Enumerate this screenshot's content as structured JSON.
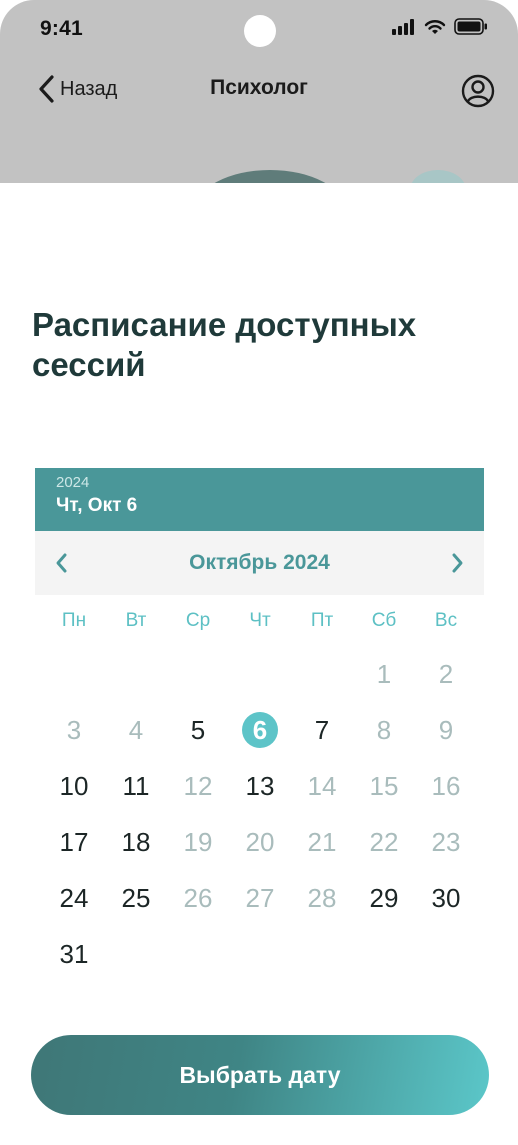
{
  "status_bar": {
    "time": "9:41",
    "icons": [
      "signal-icon",
      "wifi-icon",
      "battery-icon"
    ]
  },
  "nav": {
    "back_label": "Назад",
    "title": "Психолог",
    "profile_icon": "user-circle-icon"
  },
  "heading": "Расписание доступных сессий",
  "calendar": {
    "year": "2024",
    "selected_label": "Чт, Окт 6",
    "month_label": "Октябрь 2024",
    "weekdays": [
      "Пн",
      "Вт",
      "Ср",
      "Чт",
      "Пт",
      "Сб",
      "Вс"
    ],
    "leading_blanks": 5,
    "days": [
      {
        "n": "1",
        "state": "disabled"
      },
      {
        "n": "2",
        "state": "disabled"
      },
      {
        "n": "3",
        "state": "disabled"
      },
      {
        "n": "4",
        "state": "disabled"
      },
      {
        "n": "5",
        "state": "available"
      },
      {
        "n": "6",
        "state": "selected"
      },
      {
        "n": "7",
        "state": "available"
      },
      {
        "n": "8",
        "state": "disabled"
      },
      {
        "n": "9",
        "state": "disabled"
      },
      {
        "n": "10",
        "state": "available"
      },
      {
        "n": "11",
        "state": "available"
      },
      {
        "n": "12",
        "state": "disabled"
      },
      {
        "n": "13",
        "state": "available"
      },
      {
        "n": "14",
        "state": "disabled"
      },
      {
        "n": "15",
        "state": "disabled"
      },
      {
        "n": "16",
        "state": "disabled"
      },
      {
        "n": "17",
        "state": "available"
      },
      {
        "n": "18",
        "state": "available"
      },
      {
        "n": "19",
        "state": "disabled"
      },
      {
        "n": "20",
        "state": "disabled"
      },
      {
        "n": "21",
        "state": "disabled"
      },
      {
        "n": "22",
        "state": "disabled"
      },
      {
        "n": "23",
        "state": "disabled"
      },
      {
        "n": "24",
        "state": "available"
      },
      {
        "n": "25",
        "state": "available"
      },
      {
        "n": "26",
        "state": "disabled"
      },
      {
        "n": "27",
        "state": "disabled"
      },
      {
        "n": "28",
        "state": "disabled"
      },
      {
        "n": "29",
        "state": "available"
      },
      {
        "n": "30",
        "state": "available"
      },
      {
        "n": "31",
        "state": "available"
      }
    ]
  },
  "cta_label": "Выбрать дату",
  "colors": {
    "accent": "#4a9799",
    "accent_light": "#5dc4c8",
    "heading": "#1f3a3a",
    "disabled_day": "#a9bcbc",
    "top_background": "#c2c2c2"
  }
}
